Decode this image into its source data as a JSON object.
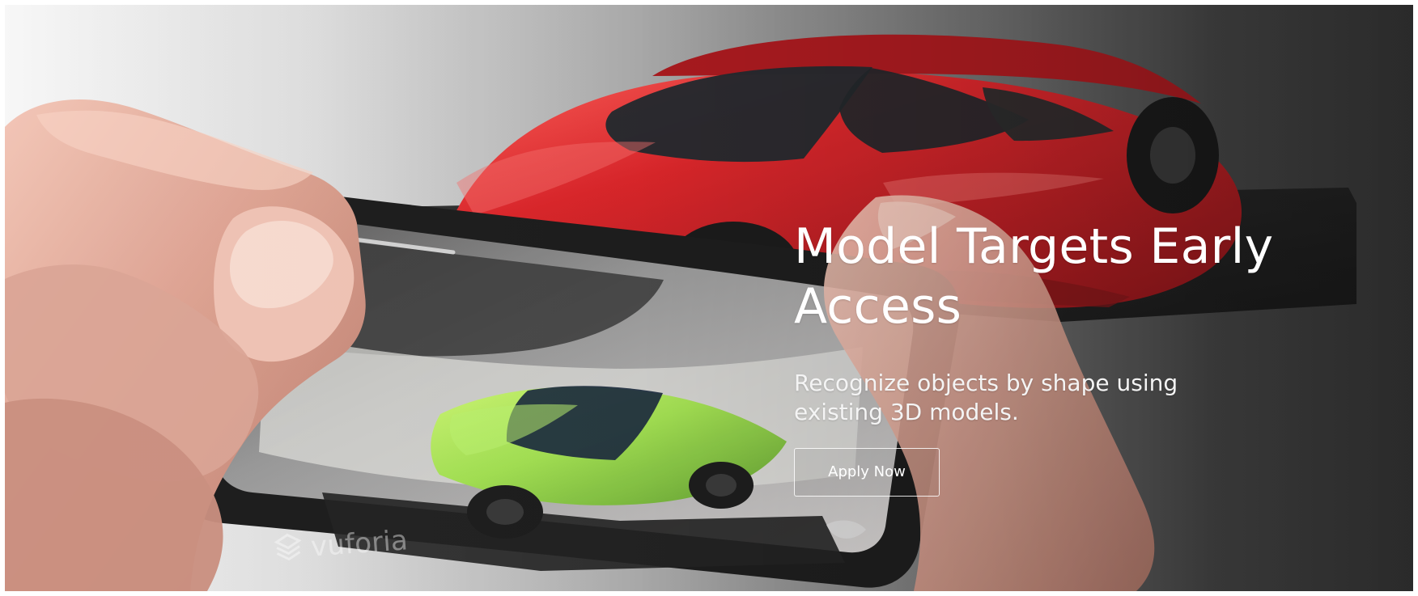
{
  "hero": {
    "title_line1": "Model Targets Early",
    "title_line2": "Access",
    "subtitle_line1": "Recognize objects by shape using",
    "subtitle_line2": "existing 3D models.",
    "button_label": "Apply Now"
  },
  "colors": {
    "text": "#ffffff",
    "red_car": "#d91f24",
    "green_car": "#9fde4d",
    "background_dark": "#343434",
    "background_light": "#f7f7f7"
  },
  "icons": {
    "vuforia_logo_icon": "vuforia-icon"
  },
  "background_photo": {
    "logo_text": "vuforia"
  }
}
